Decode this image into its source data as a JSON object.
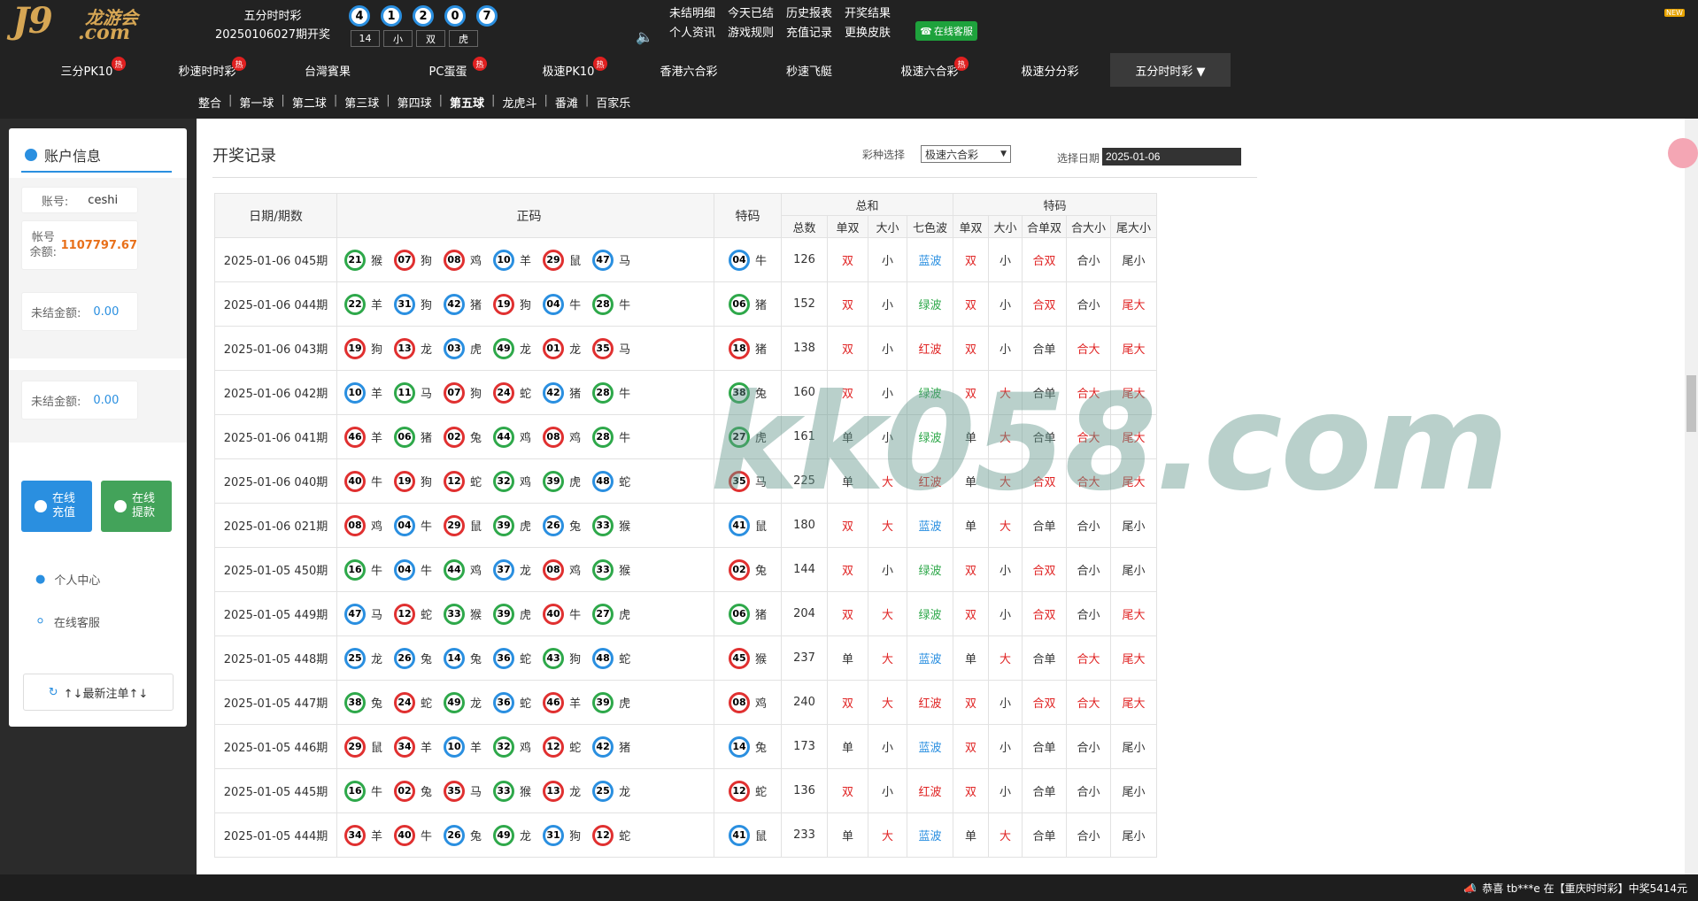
{
  "header": {
    "logo_main": "J9",
    "logo_cn": "龙游会",
    "logo_sub": ".com",
    "lottery_name": "五分时时彩",
    "lottery_issue": "20250106027期开奖",
    "result_balls": [
      "4",
      "1",
      "2",
      "0",
      "7"
    ],
    "result_tags": [
      "14",
      "小",
      "双",
      "虎"
    ],
    "top_links": [
      "未结明细",
      "今天已结",
      "历史报表",
      "开奖结果",
      "个人资讯",
      "游戏规则",
      "充值记录",
      "更换皮肤"
    ],
    "online_service": "在线客服",
    "new_badge": "NEW",
    "hot_label": "热"
  },
  "nav": [
    {
      "label": "三分PK10",
      "hot": true
    },
    {
      "label": "秒速时时彩",
      "hot": true
    },
    {
      "label": "台灣賓果",
      "hot": false
    },
    {
      "label": "PC蛋蛋",
      "hot": true
    },
    {
      "label": "极速PK10",
      "hot": true
    },
    {
      "label": "香港六合彩",
      "hot": false
    },
    {
      "label": "秒速飞艇",
      "hot": false
    },
    {
      "label": "极速六合彩",
      "hot": true
    },
    {
      "label": "极速分分彩",
      "hot": false
    },
    {
      "label": "五分时时彩 ▼",
      "hot": false,
      "active": true
    }
  ],
  "subnav": [
    "整合",
    "第一球",
    "第二球",
    "第三球",
    "第四球",
    "第五球",
    "龙虎斗",
    "番滩",
    "百家乐"
  ],
  "sidebar": {
    "title": "账户信息",
    "account_label": "账号:",
    "account_value": "ceshi",
    "balance_label": "帐号余额:",
    "balance_value": "1107797.67",
    "unsettled_label": "未结金额:",
    "unsettled_value": "0.00",
    "unsettled_label2": "未结金额:",
    "unsettled_value2": "0.00",
    "recharge_btn": "在线充值",
    "withdraw_btn": "在线提款",
    "personal_center": "个人中心",
    "online_service": "在线客服",
    "latest_bets": "↑↓最新注单↑↓"
  },
  "main": {
    "title": "开奖记录",
    "lottery_select_label": "彩种选择",
    "lottery_select_value": "极速六合彩",
    "date_label": "选择日期",
    "date_value": "2025-01-06",
    "headers": {
      "date_issue": "日期/期数",
      "main_numbers": "正码",
      "special": "特码",
      "sum_group": "总和",
      "special_group": "特码",
      "sub": [
        "总数",
        "单双",
        "大小",
        "七色波",
        "单双",
        "大小",
        "合单双",
        "合大小",
        "尾大小"
      ]
    },
    "rows": [
      {
        "date": "2025-01-06 045期",
        "nums": [
          [
            "21",
            "猴",
            "green"
          ],
          [
            "07",
            "狗",
            "red"
          ],
          [
            "08",
            "鸡",
            "red"
          ],
          [
            "10",
            "羊",
            "blue"
          ],
          [
            "29",
            "鼠",
            "red"
          ],
          [
            "47",
            "马",
            "blue"
          ]
        ],
        "sp": [
          "04",
          "牛",
          "blue"
        ],
        "total": "126",
        "s_oe": "双",
        "s_bs": "小",
        "wave": "蓝波",
        "t_oe": "双",
        "t_bs": "小",
        "t_hoe": "合双",
        "t_hbs": "合小",
        "t_tail": "尾小"
      },
      {
        "date": "2025-01-06 044期",
        "nums": [
          [
            "22",
            "羊",
            "green"
          ],
          [
            "31",
            "狗",
            "blue"
          ],
          [
            "42",
            "猪",
            "blue"
          ],
          [
            "19",
            "狗",
            "red"
          ],
          [
            "04",
            "牛",
            "blue"
          ],
          [
            "28",
            "牛",
            "green"
          ]
        ],
        "sp": [
          "06",
          "猪",
          "green"
        ],
        "total": "152",
        "s_oe": "双",
        "s_bs": "小",
        "wave": "绿波",
        "t_oe": "双",
        "t_bs": "小",
        "t_hoe": "合双",
        "t_hbs": "合小",
        "t_tail": "尾大"
      },
      {
        "date": "2025-01-06 043期",
        "nums": [
          [
            "19",
            "狗",
            "red"
          ],
          [
            "13",
            "龙",
            "red"
          ],
          [
            "03",
            "虎",
            "blue"
          ],
          [
            "49",
            "龙",
            "green"
          ],
          [
            "01",
            "龙",
            "red"
          ],
          [
            "35",
            "马",
            "red"
          ]
        ],
        "sp": [
          "18",
          "猪",
          "red"
        ],
        "total": "138",
        "s_oe": "双",
        "s_bs": "小",
        "wave": "红波",
        "t_oe": "双",
        "t_bs": "小",
        "t_hoe": "合单",
        "t_hbs": "合大",
        "t_tail": "尾大"
      },
      {
        "date": "2025-01-06 042期",
        "nums": [
          [
            "10",
            "羊",
            "blue"
          ],
          [
            "11",
            "马",
            "green"
          ],
          [
            "07",
            "狗",
            "red"
          ],
          [
            "24",
            "蛇",
            "red"
          ],
          [
            "42",
            "猪",
            "blue"
          ],
          [
            "28",
            "牛",
            "green"
          ]
        ],
        "sp": [
          "38",
          "兔",
          "green"
        ],
        "total": "160",
        "s_oe": "双",
        "s_bs": "小",
        "wave": "绿波",
        "t_oe": "双",
        "t_bs": "大",
        "t_hoe": "合单",
        "t_hbs": "合大",
        "t_tail": "尾大"
      },
      {
        "date": "2025-01-06 041期",
        "nums": [
          [
            "46",
            "羊",
            "red"
          ],
          [
            "06",
            "猪",
            "green"
          ],
          [
            "02",
            "兔",
            "red"
          ],
          [
            "44",
            "鸡",
            "green"
          ],
          [
            "08",
            "鸡",
            "red"
          ],
          [
            "28",
            "牛",
            "green"
          ]
        ],
        "sp": [
          "27",
          "虎",
          "green"
        ],
        "total": "161",
        "s_oe": "单",
        "s_bs": "小",
        "wave": "绿波",
        "t_oe": "单",
        "t_bs": "大",
        "t_hoe": "合单",
        "t_hbs": "合大",
        "t_tail": "尾大"
      },
      {
        "date": "2025-01-06 040期",
        "nums": [
          [
            "40",
            "牛",
            "red"
          ],
          [
            "19",
            "狗",
            "red"
          ],
          [
            "12",
            "蛇",
            "red"
          ],
          [
            "32",
            "鸡",
            "green"
          ],
          [
            "39",
            "虎",
            "green"
          ],
          [
            "48",
            "蛇",
            "blue"
          ]
        ],
        "sp": [
          "35",
          "马",
          "red"
        ],
        "total": "225",
        "s_oe": "单",
        "s_bs": "大",
        "wave": "红波",
        "t_oe": "单",
        "t_bs": "大",
        "t_hoe": "合双",
        "t_hbs": "合大",
        "t_tail": "尾大"
      },
      {
        "date": "2025-01-06 021期",
        "nums": [
          [
            "08",
            "鸡",
            "red"
          ],
          [
            "04",
            "牛",
            "blue"
          ],
          [
            "29",
            "鼠",
            "red"
          ],
          [
            "39",
            "虎",
            "green"
          ],
          [
            "26",
            "兔",
            "blue"
          ],
          [
            "33",
            "猴",
            "green"
          ]
        ],
        "sp": [
          "41",
          "鼠",
          "blue"
        ],
        "total": "180",
        "s_oe": "双",
        "s_bs": "大",
        "wave": "蓝波",
        "t_oe": "单",
        "t_bs": "大",
        "t_hoe": "合单",
        "t_hbs": "合小",
        "t_tail": "尾小"
      },
      {
        "date": "2025-01-05 450期",
        "nums": [
          [
            "16",
            "牛",
            "green"
          ],
          [
            "04",
            "牛",
            "blue"
          ],
          [
            "44",
            "鸡",
            "green"
          ],
          [
            "37",
            "龙",
            "blue"
          ],
          [
            "08",
            "鸡",
            "red"
          ],
          [
            "33",
            "猴",
            "green"
          ]
        ],
        "sp": [
          "02",
          "兔",
          "red"
        ],
        "total": "144",
        "s_oe": "双",
        "s_bs": "小",
        "wave": "绿波",
        "t_oe": "双",
        "t_bs": "小",
        "t_hoe": "合双",
        "t_hbs": "合小",
        "t_tail": "尾小"
      },
      {
        "date": "2025-01-05 449期",
        "nums": [
          [
            "47",
            "马",
            "blue"
          ],
          [
            "12",
            "蛇",
            "red"
          ],
          [
            "33",
            "猴",
            "green"
          ],
          [
            "39",
            "虎",
            "green"
          ],
          [
            "40",
            "牛",
            "red"
          ],
          [
            "27",
            "虎",
            "green"
          ]
        ],
        "sp": [
          "06",
          "猪",
          "green"
        ],
        "total": "204",
        "s_oe": "双",
        "s_bs": "大",
        "wave": "绿波",
        "t_oe": "双",
        "t_bs": "小",
        "t_hoe": "合双",
        "t_hbs": "合小",
        "t_tail": "尾大"
      },
      {
        "date": "2025-01-05 448期",
        "nums": [
          [
            "25",
            "龙",
            "blue"
          ],
          [
            "26",
            "兔",
            "blue"
          ],
          [
            "14",
            "兔",
            "blue"
          ],
          [
            "36",
            "蛇",
            "blue"
          ],
          [
            "43",
            "狗",
            "green"
          ],
          [
            "48",
            "蛇",
            "blue"
          ]
        ],
        "sp": [
          "45",
          "猴",
          "red"
        ],
        "total": "237",
        "s_oe": "单",
        "s_bs": "大",
        "wave": "蓝波",
        "t_oe": "单",
        "t_bs": "大",
        "t_hoe": "合单",
        "t_hbs": "合大",
        "t_tail": "尾大"
      },
      {
        "date": "2025-01-05 447期",
        "nums": [
          [
            "38",
            "兔",
            "green"
          ],
          [
            "24",
            "蛇",
            "red"
          ],
          [
            "49",
            "龙",
            "green"
          ],
          [
            "36",
            "蛇",
            "blue"
          ],
          [
            "46",
            "羊",
            "red"
          ],
          [
            "39",
            "虎",
            "green"
          ]
        ],
        "sp": [
          "08",
          "鸡",
          "red"
        ],
        "total": "240",
        "s_oe": "双",
        "s_bs": "大",
        "wave": "红波",
        "t_oe": "双",
        "t_bs": "小",
        "t_hoe": "合双",
        "t_hbs": "合大",
        "t_tail": "尾大"
      },
      {
        "date": "2025-01-05 446期",
        "nums": [
          [
            "29",
            "鼠",
            "red"
          ],
          [
            "34",
            "羊",
            "red"
          ],
          [
            "10",
            "羊",
            "blue"
          ],
          [
            "32",
            "鸡",
            "green"
          ],
          [
            "12",
            "蛇",
            "red"
          ],
          [
            "42",
            "猪",
            "blue"
          ]
        ],
        "sp": [
          "14",
          "兔",
          "blue"
        ],
        "total": "173",
        "s_oe": "单",
        "s_bs": "小",
        "wave": "蓝波",
        "t_oe": "双",
        "t_bs": "小",
        "t_hoe": "合单",
        "t_hbs": "合小",
        "t_tail": "尾小"
      },
      {
        "date": "2025-01-05 445期",
        "nums": [
          [
            "16",
            "牛",
            "green"
          ],
          [
            "02",
            "兔",
            "red"
          ],
          [
            "35",
            "马",
            "red"
          ],
          [
            "33",
            "猴",
            "green"
          ],
          [
            "13",
            "龙",
            "red"
          ],
          [
            "25",
            "龙",
            "blue"
          ]
        ],
        "sp": [
          "12",
          "蛇",
          "red"
        ],
        "total": "136",
        "s_oe": "双",
        "s_bs": "小",
        "wave": "红波",
        "t_oe": "双",
        "t_bs": "小",
        "t_hoe": "合单",
        "t_hbs": "合小",
        "t_tail": "尾小"
      },
      {
        "date": "2025-01-05 444期",
        "nums": [
          [
            "34",
            "羊",
            "red"
          ],
          [
            "40",
            "牛",
            "red"
          ],
          [
            "26",
            "兔",
            "blue"
          ],
          [
            "49",
            "龙",
            "green"
          ],
          [
            "31",
            "狗",
            "blue"
          ],
          [
            "12",
            "蛇",
            "red"
          ]
        ],
        "sp": [
          "41",
          "鼠",
          "blue"
        ],
        "total": "233",
        "s_oe": "单",
        "s_bs": "大",
        "wave": "蓝波",
        "t_oe": "单",
        "t_bs": "大",
        "t_hoe": "合单",
        "t_hbs": "合小",
        "t_tail": "尾小"
      }
    ]
  },
  "watermark": "kk058.com",
  "footer": {
    "text": "恭喜 tb***e 在【重庆时时彩】中奖5414元"
  }
}
